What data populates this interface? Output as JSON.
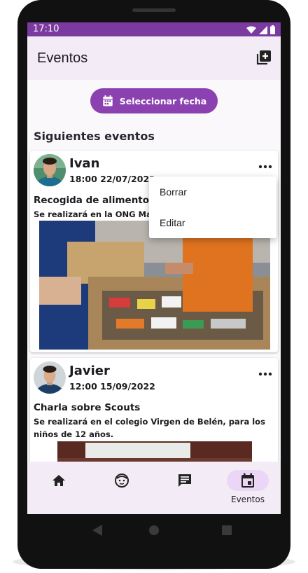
{
  "status_bar": {
    "time": "17:10"
  },
  "app_bar": {
    "title": "Eventos"
  },
  "date_button": {
    "label": "Seleccionar fecha"
  },
  "section": {
    "title": "Siguientes eventos"
  },
  "events": [
    {
      "user": "Ivan",
      "datetime": "18:00 22/07/2022",
      "title": "Recogida de alimentos",
      "description": "Se realizará en la ONG Man"
    },
    {
      "user": "Javier",
      "datetime": "12:00 15/09/2022",
      "title": "Charla sobre Scouts",
      "description": "Se realizará en el colegio Virgen de Belén, para los niños de 12 años."
    }
  ],
  "menu": {
    "items": [
      "Borrar",
      "Editar"
    ]
  },
  "bottom_nav": {
    "items": [
      {
        "icon": "home-icon",
        "label": ""
      },
      {
        "icon": "face-icon",
        "label": ""
      },
      {
        "icon": "chat-icon",
        "label": ""
      },
      {
        "icon": "calendar-icon",
        "label": "Eventos",
        "selected": true
      }
    ]
  },
  "colors": {
    "primary": "#8b41b0",
    "status_bar": "#7b3aa0",
    "surface": "#f3ecf6",
    "nav_pill": "#ecd6f6"
  }
}
